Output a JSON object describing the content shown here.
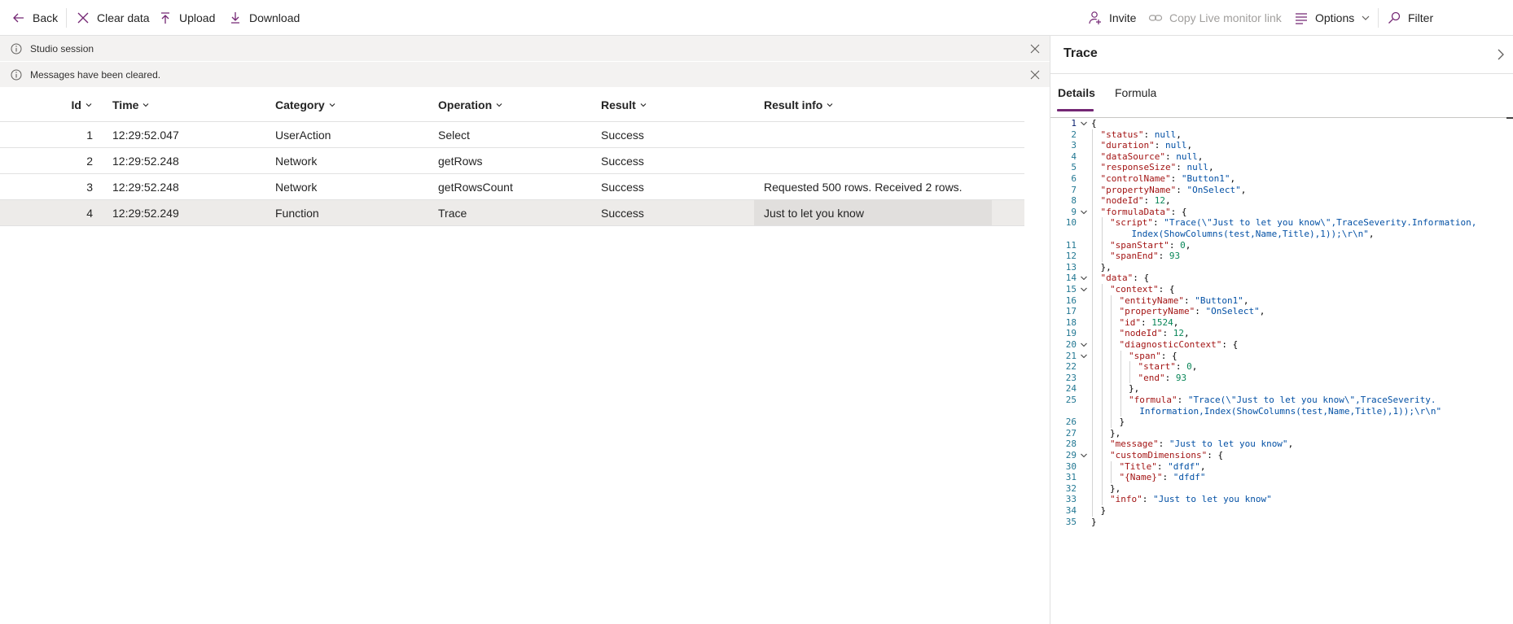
{
  "toolbar": {
    "back": "Back",
    "clear_data": "Clear data",
    "upload": "Upload",
    "download": "Download",
    "invite": "Invite",
    "copy_live_monitor_link": "Copy Live monitor link",
    "options": "Options",
    "filter": "Filter"
  },
  "banners": [
    {
      "text": "Studio session"
    },
    {
      "text": "Messages have been cleared."
    }
  ],
  "grid": {
    "columns": [
      "Id",
      "Time",
      "Category",
      "Operation",
      "Result",
      "Result info"
    ],
    "rows": [
      {
        "id": "1",
        "time": "12:29:52.047",
        "category": "UserAction",
        "operation": "Select",
        "result": "Success",
        "result_info": ""
      },
      {
        "id": "2",
        "time": "12:29:52.248",
        "category": "Network",
        "operation": "getRows",
        "result": "Success",
        "result_info": ""
      },
      {
        "id": "3",
        "time": "12:29:52.248",
        "category": "Network",
        "operation": "getRowsCount",
        "result": "Success",
        "result_info": "Requested 500 rows. Received 2 rows."
      },
      {
        "id": "4",
        "time": "12:29:52.249",
        "category": "Function",
        "operation": "Trace",
        "result": "Success",
        "result_info": "Just to let you know"
      }
    ],
    "selected_row": 4
  },
  "details_panel": {
    "title": "Trace",
    "tabs": [
      {
        "label": "Details",
        "active": true
      },
      {
        "label": "Formula",
        "active": false
      }
    ],
    "code_lines": [
      {
        "n": "1",
        "indent": 0,
        "fold": true,
        "html": "<span class='p'>{</span>"
      },
      {
        "n": "2",
        "indent": 1,
        "fold": false,
        "html": "<span class='k'>\"status\"</span><span class='p'>: </span><span class='nl'>null</span><span class='p'>,</span>"
      },
      {
        "n": "3",
        "indent": 1,
        "fold": false,
        "html": "<span class='k'>\"duration\"</span><span class='p'>: </span><span class='nl'>null</span><span class='p'>,</span>"
      },
      {
        "n": "4",
        "indent": 1,
        "fold": false,
        "html": "<span class='k'>\"dataSource\"</span><span class='p'>: </span><span class='nl'>null</span><span class='p'>,</span>"
      },
      {
        "n": "5",
        "indent": 1,
        "fold": false,
        "html": "<span class='k'>\"responseSize\"</span><span class='p'>: </span><span class='nl'>null</span><span class='p'>,</span>"
      },
      {
        "n": "6",
        "indent": 1,
        "fold": false,
        "html": "<span class='k'>\"controlName\"</span><span class='p'>: </span><span class='s'>\"Button1\"</span><span class='p'>,</span>"
      },
      {
        "n": "7",
        "indent": 1,
        "fold": false,
        "html": "<span class='k'>\"propertyName\"</span><span class='p'>: </span><span class='s'>\"OnSelect\"</span><span class='p'>,</span>"
      },
      {
        "n": "8",
        "indent": 1,
        "fold": false,
        "html": "<span class='k'>\"nodeId\"</span><span class='p'>: </span><span class='n'>12</span><span class='p'>,</span>"
      },
      {
        "n": "9",
        "indent": 1,
        "fold": true,
        "html": "<span class='k'>\"formulaData\"</span><span class='p'>: {</span>"
      },
      {
        "n": "10",
        "indent": 2,
        "fold": false,
        "html": "<span class='k'>\"script\"</span><span class='p'>: </span><span class='s'>\"Trace(\\\"Just to let you know\\\",TraceSeverity.Information,</span>"
      },
      {
        "n": "",
        "indent": 2,
        "fold": false,
        "html": "<span class='s'>    Index(ShowColumns(test,Name,Title),1));\\r\\n\"</span><span class='p'>,</span>"
      },
      {
        "n": "11",
        "indent": 2,
        "fold": false,
        "html": "<span class='k'>\"spanStart\"</span><span class='p'>: </span><span class='n'>0</span><span class='p'>,</span>"
      },
      {
        "n": "12",
        "indent": 2,
        "fold": false,
        "html": "<span class='k'>\"spanEnd\"</span><span class='p'>: </span><span class='n'>93</span>"
      },
      {
        "n": "13",
        "indent": 1,
        "fold": false,
        "html": "<span class='p'>},</span>"
      },
      {
        "n": "14",
        "indent": 1,
        "fold": true,
        "html": "<span class='k'>\"data\"</span><span class='p'>: {</span>"
      },
      {
        "n": "15",
        "indent": 2,
        "fold": true,
        "html": "<span class='k'>\"context\"</span><span class='p'>: {</span>"
      },
      {
        "n": "16",
        "indent": 3,
        "fold": false,
        "html": "<span class='k'>\"entityName\"</span><span class='p'>: </span><span class='s'>\"Button1\"</span><span class='p'>,</span>"
      },
      {
        "n": "17",
        "indent": 3,
        "fold": false,
        "html": "<span class='k'>\"propertyName\"</span><span class='p'>: </span><span class='s'>\"OnSelect\"</span><span class='p'>,</span>"
      },
      {
        "n": "18",
        "indent": 3,
        "fold": false,
        "html": "<span class='k'>\"id\"</span><span class='p'>: </span><span class='n'>1524</span><span class='p'>,</span>"
      },
      {
        "n": "19",
        "indent": 3,
        "fold": false,
        "html": "<span class='k'>\"nodeId\"</span><span class='p'>: </span><span class='n'>12</span><span class='p'>,</span>"
      },
      {
        "n": "20",
        "indent": 3,
        "fold": true,
        "html": "<span class='k'>\"diagnosticContext\"</span><span class='p'>: {</span>"
      },
      {
        "n": "21",
        "indent": 4,
        "fold": true,
        "html": "<span class='k'>\"span\"</span><span class='p'>: {</span>"
      },
      {
        "n": "22",
        "indent": 5,
        "fold": false,
        "html": "<span class='k'>\"start\"</span><span class='p'>: </span><span class='n'>0</span><span class='p'>,</span>"
      },
      {
        "n": "23",
        "indent": 5,
        "fold": false,
        "html": "<span class='k'>\"end\"</span><span class='p'>: </span><span class='n'>93</span>"
      },
      {
        "n": "24",
        "indent": 4,
        "fold": false,
        "html": "<span class='p'>},</span>"
      },
      {
        "n": "25",
        "indent": 4,
        "fold": false,
        "html": "<span class='k'>\"formula\"</span><span class='p'>: </span><span class='s'>\"Trace(\\\"Just to let you know\\\",TraceSeverity.</span>"
      },
      {
        "n": "",
        "indent": 4,
        "fold": false,
        "html": "<span class='s'>  Information,Index(ShowColumns(test,Name,Title),1));\\r\\n\"</span>"
      },
      {
        "n": "26",
        "indent": 3,
        "fold": false,
        "html": "<span class='p'>}</span>"
      },
      {
        "n": "27",
        "indent": 2,
        "fold": false,
        "html": "<span class='p'>},</span>"
      },
      {
        "n": "28",
        "indent": 2,
        "fold": false,
        "html": "<span class='k'>\"message\"</span><span class='p'>: </span><span class='s'>\"Just to let you know\"</span><span class='p'>,</span>"
      },
      {
        "n": "29",
        "indent": 2,
        "fold": true,
        "html": "<span class='k'>\"customDimensions\"</span><span class='p'>: {</span>"
      },
      {
        "n": "30",
        "indent": 3,
        "fold": false,
        "html": "<span class='k'>\"Title\"</span><span class='p'>: </span><span class='s'>\"dfdf\"</span><span class='p'>,</span>"
      },
      {
        "n": "31",
        "indent": 3,
        "fold": false,
        "html": "<span class='k'>\"{Name}\"</span><span class='p'>: </span><span class='s'>\"dfdf\"</span>"
      },
      {
        "n": "32",
        "indent": 2,
        "fold": false,
        "html": "<span class='p'>},</span>"
      },
      {
        "n": "33",
        "indent": 2,
        "fold": false,
        "html": "<span class='k'>\"info\"</span><span class='p'>: </span><span class='s'>\"Just to let you know\"</span>"
      },
      {
        "n": "34",
        "indent": 1,
        "fold": false,
        "html": "<span class='p'>}</span>"
      },
      {
        "n": "35",
        "indent": 0,
        "fold": false,
        "html": "<span class='p'>}</span>"
      }
    ]
  },
  "colors": {
    "accent": "#742774",
    "selected_row": "#edebe9",
    "banner_bg": "#f3f2f1",
    "json_key": "#a31515",
    "json_string": "#0451a5",
    "json_number": "#098658"
  },
  "icons": {
    "back": "arrow-left-icon",
    "clear_data": "x-icon",
    "upload": "arrow-up-icon",
    "download": "arrow-down-icon",
    "invite": "person-add-icon",
    "copy_link": "link-icon",
    "options": "list-icon",
    "filter": "search-icon",
    "banner": "info-icon",
    "close": "close-icon",
    "collapse": "chevron-right-icon"
  }
}
